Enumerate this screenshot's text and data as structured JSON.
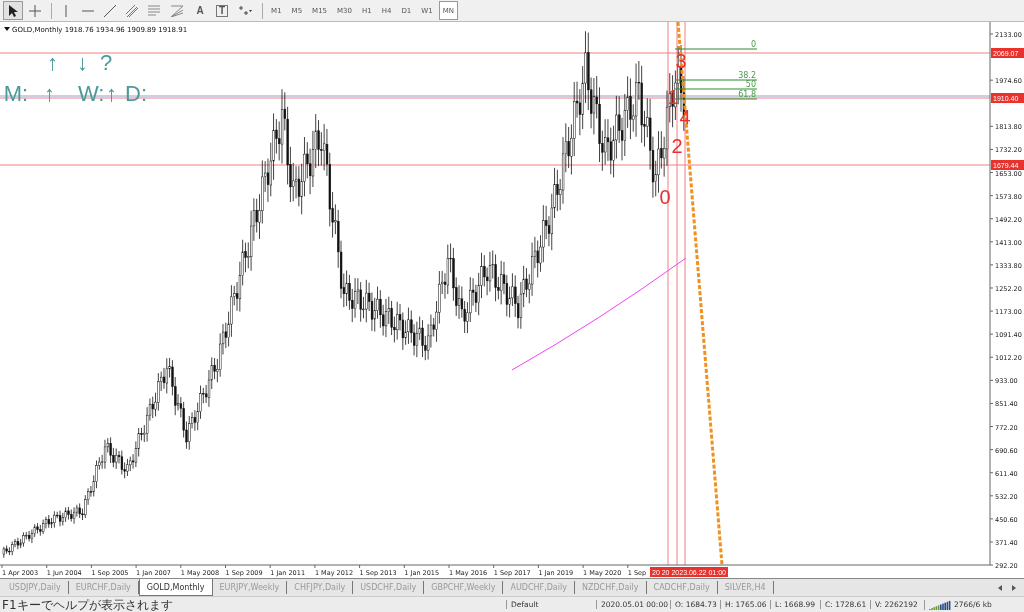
{
  "toolbar": {
    "tools": [
      {
        "kind": "cursor",
        "selected": true
      },
      {
        "kind": "crosshair",
        "selected": false
      },
      {
        "kind": "vline",
        "selected": false
      },
      {
        "kind": "hline",
        "selected": false
      },
      {
        "kind": "trendline",
        "selected": false
      },
      {
        "kind": "channel",
        "selected": false
      },
      {
        "kind": "fibo",
        "selected": false
      },
      {
        "kind": "fibofan",
        "selected": false
      },
      {
        "kind": "text",
        "label": "A",
        "selected": false
      },
      {
        "kind": "label",
        "label": "T",
        "selected": false
      },
      {
        "kind": "arrows",
        "selected": false
      }
    ],
    "timeframes": [
      {
        "label": "M1",
        "selected": false
      },
      {
        "label": "M5",
        "selected": false
      },
      {
        "label": "M15",
        "selected": false
      },
      {
        "label": "M30",
        "selected": false
      },
      {
        "label": "H1",
        "selected": false
      },
      {
        "label": "H4",
        "selected": false
      },
      {
        "label": "D1",
        "selected": false
      },
      {
        "label": "W1",
        "selected": false
      },
      {
        "label": "MN",
        "selected": true
      }
    ]
  },
  "chart": {
    "header": "GOLD,Monthly  1918.76 1934.96 1909.89 1918.91",
    "signal_rows": [
      [
        "↑",
        "↓",
        "?"
      ],
      [
        "M:",
        "↑",
        "W:",
        "↑",
        "D:"
      ]
    ],
    "wave_labels": [
      "3",
      "1",
      "4",
      "2",
      "0"
    ],
    "price_tags": [
      "2069.07",
      "1910.40",
      "1679.44"
    ],
    "fibonacci_levels": [
      "0",
      "38.2",
      "50",
      "61.8"
    ],
    "price_ticks": [
      "2133.00",
      "1974.60",
      "1813.80",
      "1732.20",
      "1653.00",
      "1573.80",
      "1492.20",
      "1413.00",
      "1333.80",
      "1252.20",
      "1173.00",
      "1091.40",
      "1012.20",
      "933.00",
      "851.40",
      "772.20",
      "690.60",
      "611.40",
      "532.20",
      "450.60",
      "371.40",
      "292.20"
    ],
    "date_ticks": [
      "1 Apr 2003",
      "1 Jun 2004",
      "1 Sep 2005",
      "1 Jan 2007",
      "1 May 2008",
      "1 Sep 2009",
      "1 Jan 2011",
      "1 May 2012",
      "1 Sep 2013",
      "1 Jan 2015",
      "1 May 2016",
      "1 Sep 2017",
      "1 Jan 2019",
      "1 May 2020",
      "1 Sep"
    ],
    "time_marker": "20 20 2023.06.22 01:00"
  },
  "tabs": [
    {
      "label": "USDJPY,Daily",
      "selected": false
    },
    {
      "label": "EURCHF,Daily",
      "selected": false
    },
    {
      "label": "GOLD,Monthly",
      "selected": true
    },
    {
      "label": "EURJPY,Weekly",
      "selected": false
    },
    {
      "label": "CHFJPY,Daily",
      "selected": false
    },
    {
      "label": "USDCHF,Daily",
      "selected": false
    },
    {
      "label": "GBPCHF,Weekly",
      "selected": false
    },
    {
      "label": "AUDCHF,Daily",
      "selected": false
    },
    {
      "label": "NZDCHF,Daily",
      "selected": false
    },
    {
      "label": "CADCHF,Daily",
      "selected": false
    },
    {
      "label": "SILVER,H4",
      "selected": false
    }
  ],
  "status_bar": {
    "help": "F1キーでヘルプが表示されます",
    "profile": "Default",
    "time": "2020.05.01 00:00",
    "open": "O: 1684.73",
    "high": "H: 1765.06",
    "low": "L: 1668.99",
    "close": "C: 1728.61",
    "volume": "V: 2262192",
    "traffic": "2766/6 kb"
  }
}
